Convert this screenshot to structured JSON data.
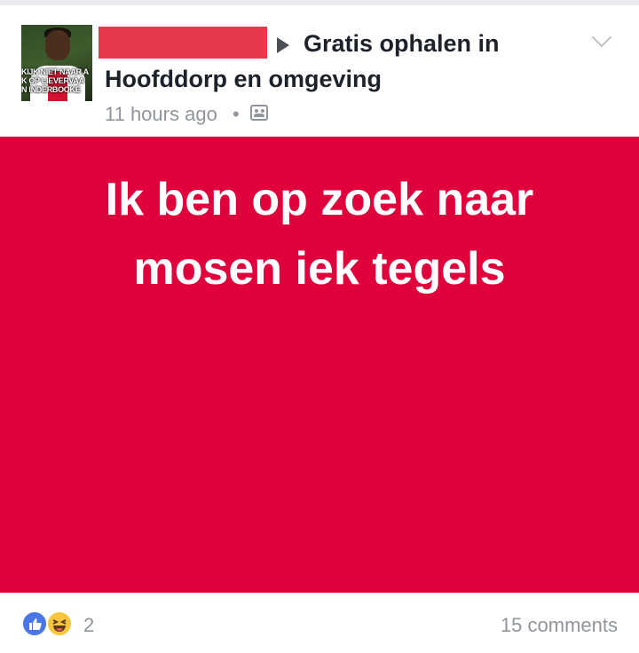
{
  "post": {
    "avatar_caption_lines": [
      "KIJK NIET NAAR A",
      "K OP LIEVERVAA",
      "N INDERBOOKE"
    ],
    "group_title_line1": "Gratis ophalen in",
    "group_title_line2": "Hoofddorp en omgeving",
    "timestamp": "11 hours ago",
    "separator": "•",
    "privacy_icon": "group-icon",
    "menu_icon": "chevron-down-icon",
    "body_lines": [
      "Ik ben op zoek naar",
      "mosen iek tegels"
    ],
    "body_background": "#e0003c",
    "redaction_color": "#e6394c"
  },
  "footer": {
    "reactions": [
      "like-icon",
      "haha-icon"
    ],
    "reaction_count": "2",
    "comments": "15 comments"
  }
}
